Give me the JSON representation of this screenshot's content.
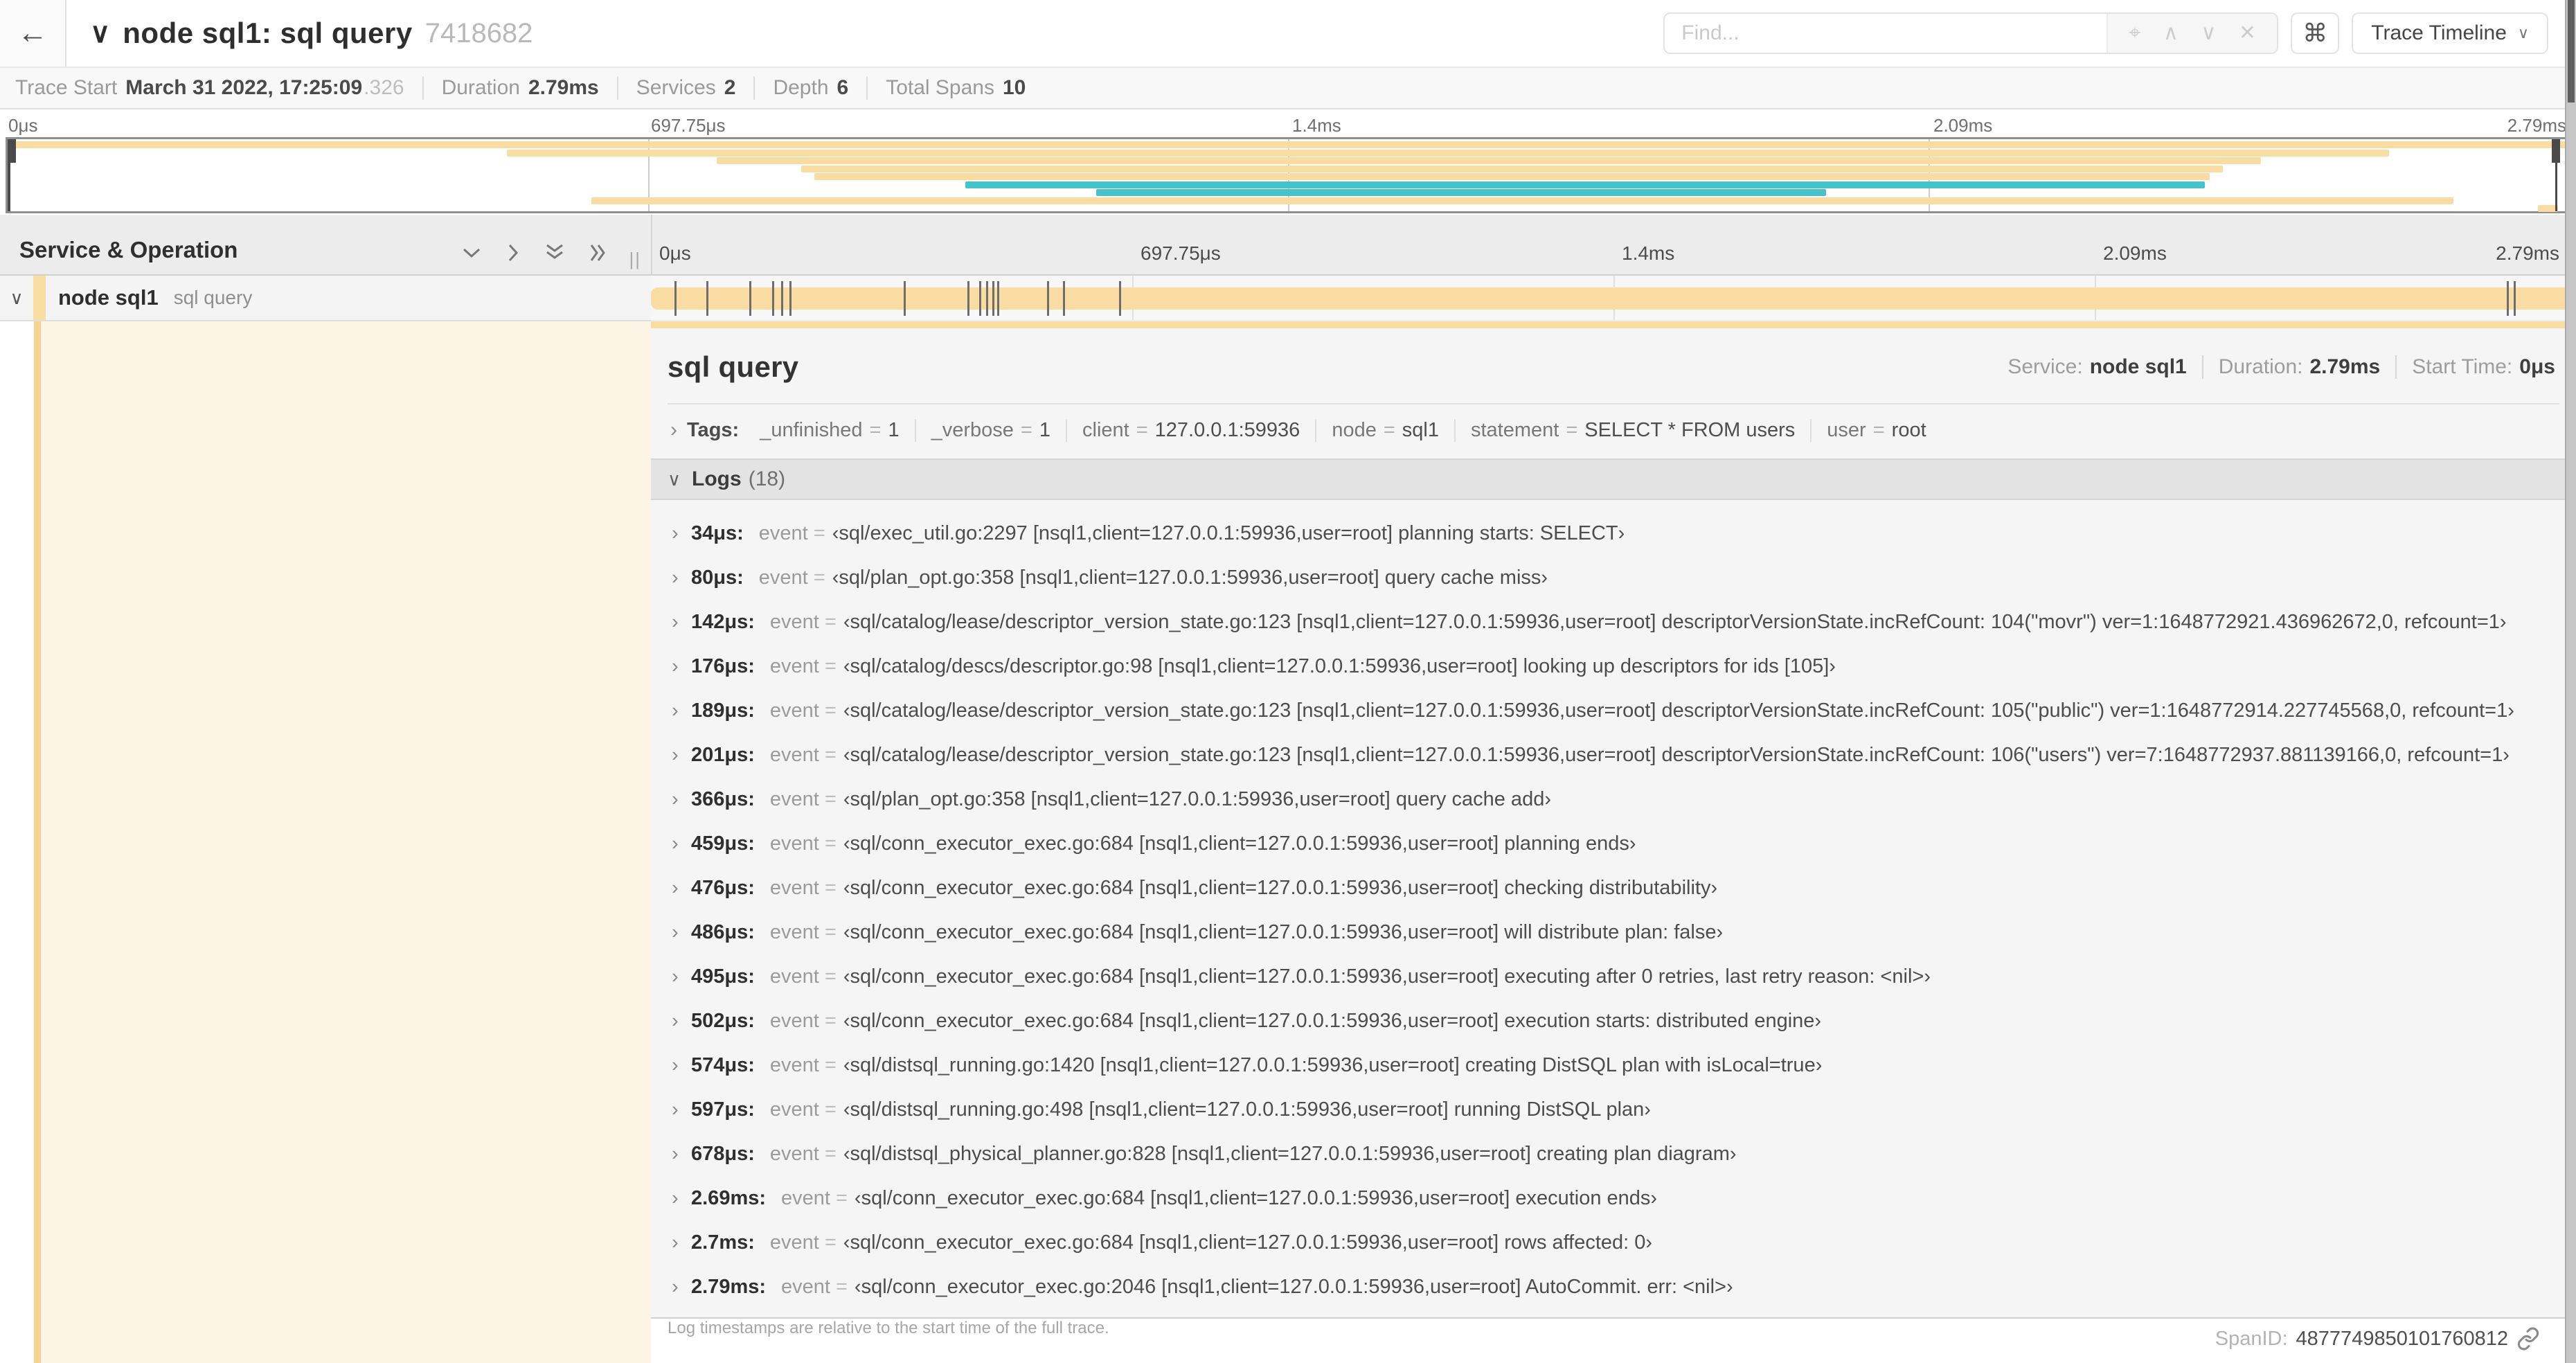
{
  "header": {
    "back_icon": "←",
    "collapse_icon": "∨",
    "title": "node sql1: sql query",
    "trace_id_short": "7418682",
    "find_placeholder": "Find...",
    "find_icons": {
      "locate": "⌖",
      "prev": "∧",
      "next": "∨",
      "clear": "✕"
    },
    "shortcut_icon": "⌘",
    "view_selector_label": "Trace Timeline",
    "view_selector_chevron": "∨"
  },
  "summary": {
    "items": [
      {
        "label": "Trace Start",
        "value": "March 31 2022, 17:25:09",
        "suffix": ".326"
      },
      {
        "label": "Duration",
        "value": "2.79ms",
        "suffix": ""
      },
      {
        "label": "Services",
        "value": "2",
        "suffix": ""
      },
      {
        "label": "Depth",
        "value": "6",
        "suffix": ""
      },
      {
        "label": "Total Spans",
        "value": "10",
        "suffix": ""
      }
    ]
  },
  "colors": {
    "tan": "#F8DCA1",
    "teal": "#46C3C9",
    "accent_stripe": "#F6D591",
    "cream": "#FCF5E6"
  },
  "minimap": {
    "ticks": [
      "0μs",
      "697.75μs",
      "1.4ms",
      "2.09ms",
      "2.79ms"
    ],
    "rows": [
      {
        "start": 0,
        "end": 100,
        "color": "tan"
      },
      {
        "start": 19.5,
        "end": 93,
        "color": "tan"
      },
      {
        "start": 27.7,
        "end": 88,
        "color": "tan"
      },
      {
        "start": 31,
        "end": 86.5,
        "color": "tan"
      },
      {
        "start": 31.5,
        "end": 86,
        "color": "tan"
      },
      {
        "start": 37.4,
        "end": 85.8,
        "color": "teal"
      },
      {
        "start": 42.5,
        "end": 71,
        "color": "teal"
      },
      {
        "start": 22.8,
        "end": 95.5,
        "color": "tan"
      },
      {
        "start": 98.8,
        "end": 99.6,
        "color": "tan"
      }
    ]
  },
  "timeline": {
    "left_header": "Service & Operation",
    "resizer_glyph": "||",
    "ticks": [
      "0μs",
      "697.75μs",
      "1.4ms",
      "2.09ms",
      "2.79ms"
    ],
    "row": {
      "chevron": "∨",
      "service": "node sql1",
      "operation": "sql query"
    },
    "log_marker_positions_pct": [
      1.22,
      2.87,
      5.09,
      6.31,
      6.77,
      7.2,
      13.12,
      16.45,
      17.06,
      17.42,
      17.74,
      17.99,
      20.57,
      21.4,
      24.3,
      96.42,
      96.77
    ]
  },
  "detail": {
    "title": "sql query",
    "overview": [
      {
        "label": "Service:",
        "value": "node sql1"
      },
      {
        "label": "Duration:",
        "value": "2.79ms"
      },
      {
        "label": "Start Time:",
        "value": "0μs"
      }
    ],
    "tags_chevron": "›",
    "tags_label": "Tags:",
    "tags": [
      {
        "key": "_unfinished",
        "value": "1"
      },
      {
        "key": "_verbose",
        "value": "1"
      },
      {
        "key": "client",
        "value": "127.0.0.1:59936"
      },
      {
        "key": "node",
        "value": "sql1"
      },
      {
        "key": "statement",
        "value": "SELECT * FROM users"
      },
      {
        "key": "user",
        "value": "root"
      }
    ],
    "logs_chevron": "∨",
    "logs_label": "Logs",
    "logs_count": "(18)",
    "log_row_chevron": "›",
    "log_field_key": "event",
    "logs": [
      {
        "time": "34μs:",
        "value": "‹sql/exec_util.go:2297 [nsql1,client=127.0.0.1:59936,user=root] planning starts: SELECT›"
      },
      {
        "time": "80μs:",
        "value": "‹sql/plan_opt.go:358 [nsql1,client=127.0.0.1:59936,user=root] query cache miss›"
      },
      {
        "time": "142μs:",
        "value": "‹sql/catalog/lease/descriptor_version_state.go:123 [nsql1,client=127.0.0.1:59936,user=root] descriptorVersionState.incRefCount: 104(\"movr\") ver=1:1648772921.436962672,0, refcount=1›"
      },
      {
        "time": "176μs:",
        "value": "‹sql/catalog/descs/descriptor.go:98 [nsql1,client=127.0.0.1:59936,user=root] looking up descriptors for ids [105]›"
      },
      {
        "time": "189μs:",
        "value": "‹sql/catalog/lease/descriptor_version_state.go:123 [nsql1,client=127.0.0.1:59936,user=root] descriptorVersionState.incRefCount: 105(\"public\") ver=1:1648772914.227745568,0, refcount=1›"
      },
      {
        "time": "201μs:",
        "value": "‹sql/catalog/lease/descriptor_version_state.go:123 [nsql1,client=127.0.0.1:59936,user=root] descriptorVersionState.incRefCount: 106(\"users\") ver=7:1648772937.881139166,0, refcount=1›"
      },
      {
        "time": "366μs:",
        "value": "‹sql/plan_opt.go:358 [nsql1,client=127.0.0.1:59936,user=root] query cache add›"
      },
      {
        "time": "459μs:",
        "value": "‹sql/conn_executor_exec.go:684 [nsql1,client=127.0.0.1:59936,user=root] planning ends›"
      },
      {
        "time": "476μs:",
        "value": "‹sql/conn_executor_exec.go:684 [nsql1,client=127.0.0.1:59936,user=root] checking distributability›"
      },
      {
        "time": "486μs:",
        "value": "‹sql/conn_executor_exec.go:684 [nsql1,client=127.0.0.1:59936,user=root] will distribute plan: false›"
      },
      {
        "time": "495μs:",
        "value": "‹sql/conn_executor_exec.go:684 [nsql1,client=127.0.0.1:59936,user=root] executing after 0 retries, last retry reason: <nil>›"
      },
      {
        "time": "502μs:",
        "value": "‹sql/conn_executor_exec.go:684 [nsql1,client=127.0.0.1:59936,user=root] execution starts: distributed engine›"
      },
      {
        "time": "574μs:",
        "value": "‹sql/distsql_running.go:1420 [nsql1,client=127.0.0.1:59936,user=root] creating DistSQL plan with isLocal=true›"
      },
      {
        "time": "597μs:",
        "value": "‹sql/distsql_running.go:498 [nsql1,client=127.0.0.1:59936,user=root] running DistSQL plan›"
      },
      {
        "time": "678μs:",
        "value": "‹sql/distsql_physical_planner.go:828 [nsql1,client=127.0.0.1:59936,user=root] creating plan diagram›"
      },
      {
        "time": "2.69ms:",
        "value": "‹sql/conn_executor_exec.go:684 [nsql1,client=127.0.0.1:59936,user=root] execution ends›"
      },
      {
        "time": "2.7ms:",
        "value": "‹sql/conn_executor_exec.go:684 [nsql1,client=127.0.0.1:59936,user=root] rows affected: 0›"
      },
      {
        "time": "2.79ms:",
        "value": "‹sql/conn_executor_exec.go:2046 [nsql1,client=127.0.0.1:59936,user=root] AutoCommit. err: <nil>›"
      }
    ],
    "footnote": "Log timestamps are relative to the start time of the full trace.",
    "span_id_label": "SpanID:",
    "span_id": "4877749850101760812"
  }
}
